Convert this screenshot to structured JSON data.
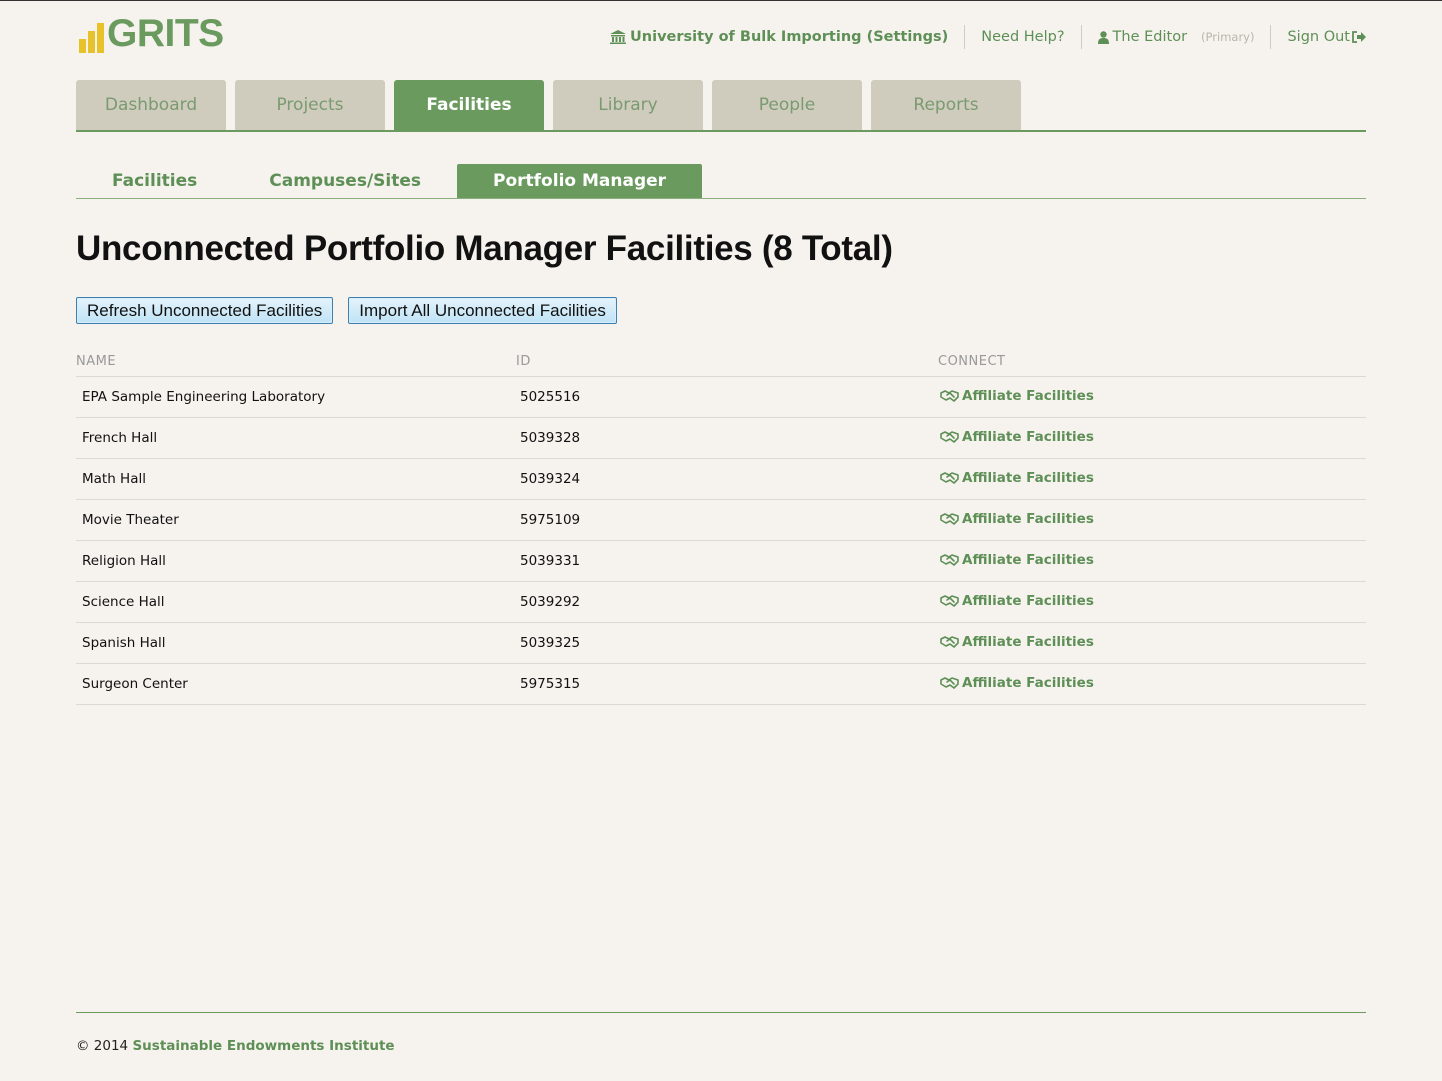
{
  "brand": {
    "logo_text": "GRITS",
    "accent": "#6a9a5e",
    "logo_bar_color": "#e8c22a"
  },
  "topnav": {
    "org": "University of Bulk Importing (Settings)",
    "org_icon": "institution-icon",
    "help": "Need Help?",
    "user": "The Editor",
    "user_icon": "user-icon",
    "user_role": "(Primary)",
    "signout": "Sign Out",
    "signout_icon": "sign-out-icon"
  },
  "main_tabs": [
    {
      "label": "Dashboard",
      "active": false
    },
    {
      "label": "Projects",
      "active": false
    },
    {
      "label": "Facilities",
      "active": true
    },
    {
      "label": "Library",
      "active": false
    },
    {
      "label": "People",
      "active": false
    },
    {
      "label": "Reports",
      "active": false
    }
  ],
  "sub_tabs": [
    {
      "label": "Facilities",
      "active": false
    },
    {
      "label": "Campuses/Sites",
      "active": false
    },
    {
      "label": "Portfolio Manager",
      "active": true
    }
  ],
  "page": {
    "title": "Unconnected Portfolio Manager Facilities (8 Total)",
    "refresh_button": "Refresh Unconnected Facilities",
    "import_button": "Import All Unconnected Facilities"
  },
  "table": {
    "headers": [
      "NAME",
      "ID",
      "CONNECT"
    ],
    "action_label": "Affiliate Facilities",
    "action_icon": "handshake-icon",
    "rows": [
      {
        "name": "EPA Sample Engineering Laboratory",
        "id": "5025516"
      },
      {
        "name": "French Hall",
        "id": "5039328"
      },
      {
        "name": "Math Hall",
        "id": "5039324"
      },
      {
        "name": "Movie Theater",
        "id": "5975109"
      },
      {
        "name": "Religion Hall",
        "id": "5039331"
      },
      {
        "name": "Science Hall",
        "id": "5039292"
      },
      {
        "name": "Spanish Hall",
        "id": "5039325"
      },
      {
        "name": "Surgeon Center",
        "id": "5975315"
      }
    ]
  },
  "footer": {
    "copyright": "© 2014",
    "org": "Sustainable Endowments Institute"
  }
}
